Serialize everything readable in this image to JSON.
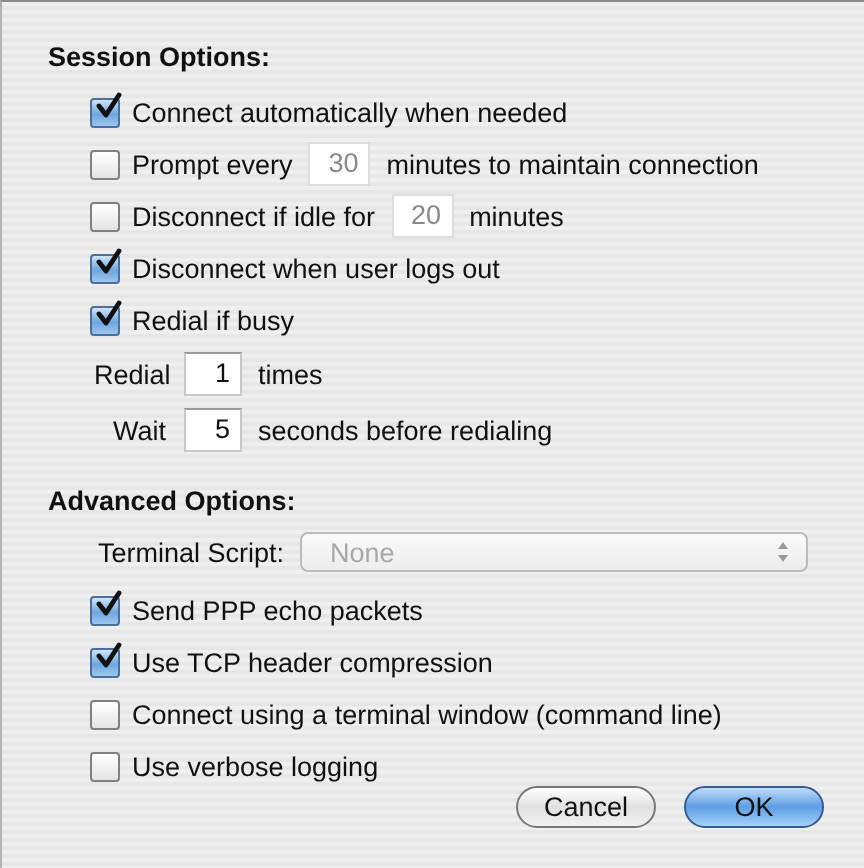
{
  "session_options": {
    "title": "Session Options:",
    "items": [
      {
        "kind": "checkbox",
        "checked": true,
        "label": "Connect automatically when needed"
      },
      {
        "kind": "checkbox",
        "checked": false,
        "label": "Prompt every",
        "field": {
          "value": "30",
          "disabled": true
        },
        "suffix": "minutes to maintain connection"
      },
      {
        "kind": "checkbox",
        "checked": false,
        "label": "Disconnect if idle for",
        "field": {
          "value": "20",
          "disabled": true
        },
        "suffix": "minutes"
      },
      {
        "kind": "checkbox",
        "checked": true,
        "label": "Disconnect when user logs out"
      },
      {
        "kind": "checkbox",
        "checked": true,
        "label": "Redial if busy"
      },
      {
        "kind": "field",
        "label": "Redial",
        "field": {
          "value": "1",
          "disabled": false
        },
        "suffix": "times"
      },
      {
        "kind": "field",
        "label": "Wait",
        "field": {
          "value": "5",
          "disabled": false
        },
        "suffix": "seconds before redialing"
      }
    ]
  },
  "advanced_options": {
    "title": "Advanced Options:",
    "terminal_script": {
      "label": "Terminal Script:",
      "value": "None",
      "disabled": true
    },
    "items": [
      {
        "kind": "checkbox",
        "checked": true,
        "label": "Send PPP echo packets"
      },
      {
        "kind": "checkbox",
        "checked": true,
        "label": "Use TCP header compression"
      },
      {
        "kind": "checkbox",
        "checked": false,
        "label": "Connect using a terminal window (command line)"
      },
      {
        "kind": "checkbox",
        "checked": false,
        "label": "Use verbose logging"
      }
    ]
  },
  "buttons": [
    {
      "label": "Cancel",
      "default": false
    },
    {
      "label": "OK",
      "default": true
    }
  ]
}
